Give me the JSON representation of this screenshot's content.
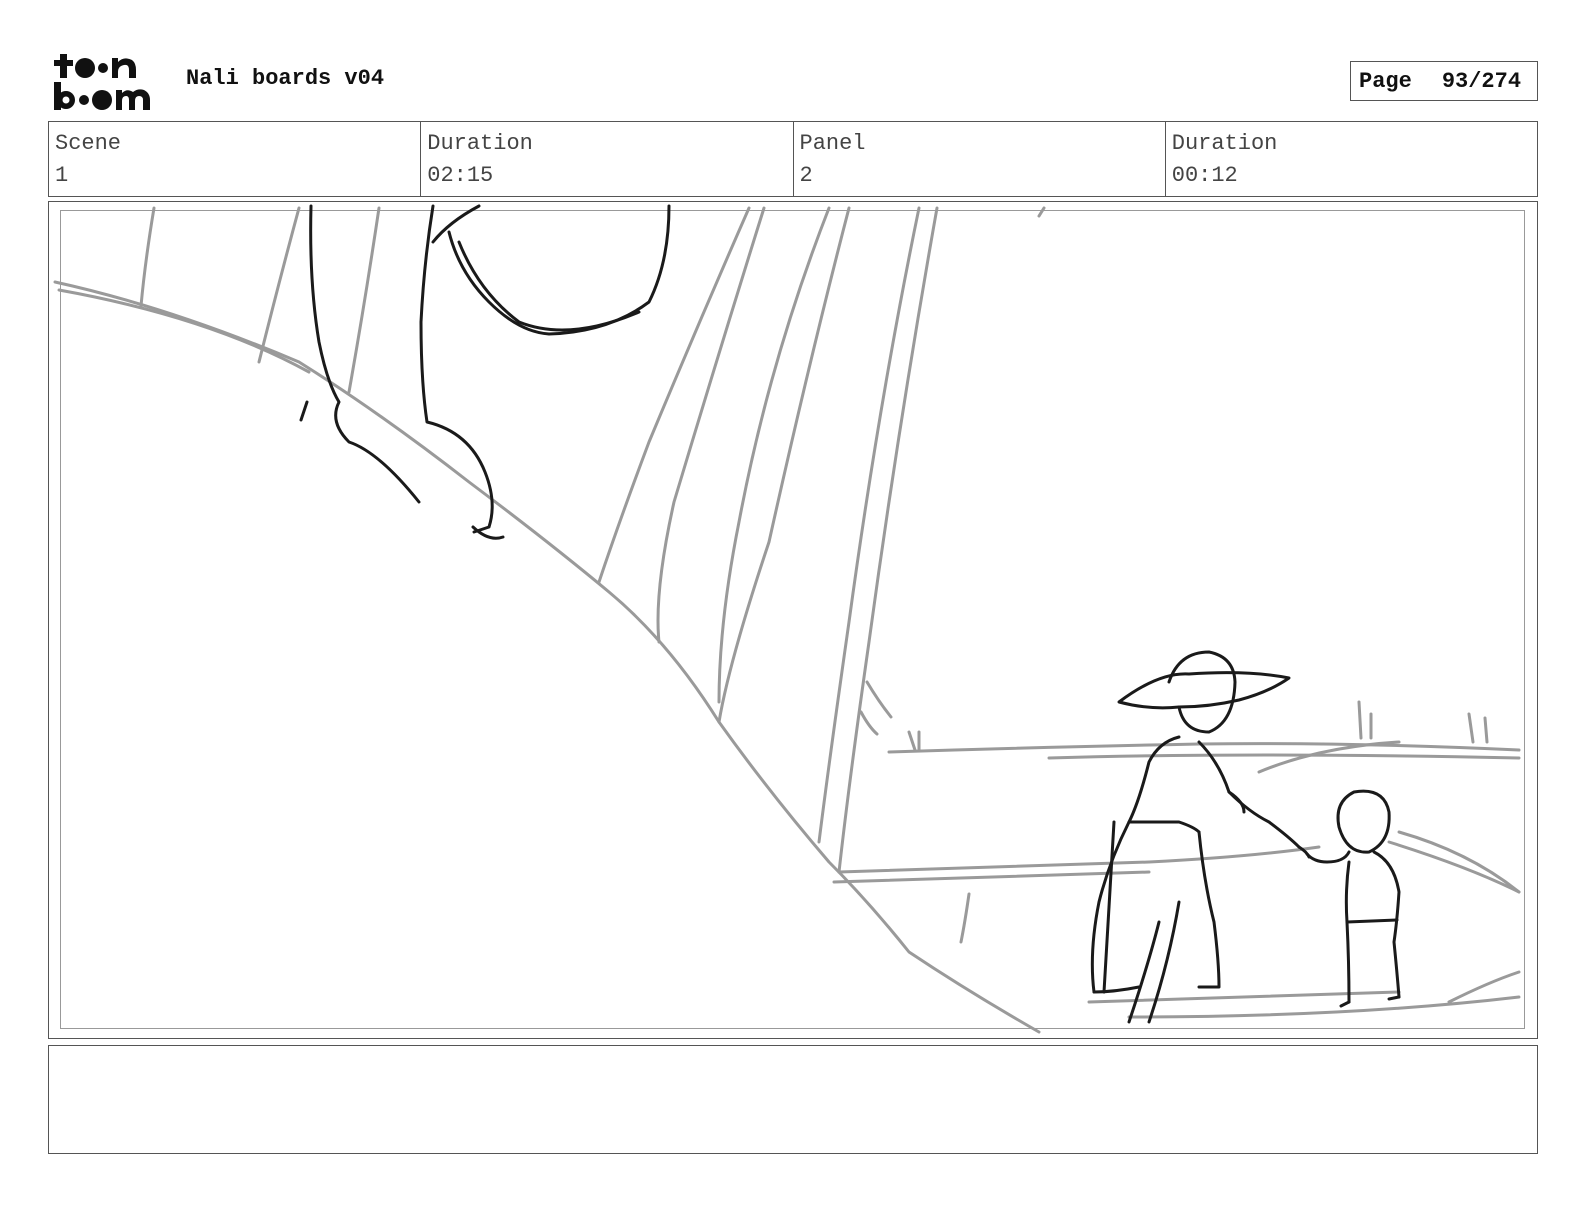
{
  "header": {
    "logo_text_top": "toon",
    "logo_text_bottom": "boom",
    "title": "Nali boards v04",
    "page_label": "Page",
    "page_number": "93/274"
  },
  "info": {
    "scene_label": "Scene",
    "scene_value": "1",
    "scene_duration_label": "Duration",
    "scene_duration_value": "02:15",
    "panel_label": "Panel",
    "panel_value": "2",
    "panel_duration_label": "Duration",
    "panel_duration_value": "00:12"
  },
  "notes": {
    "text": ""
  },
  "icons": {
    "logo": "toon-boom-logo-icon"
  }
}
